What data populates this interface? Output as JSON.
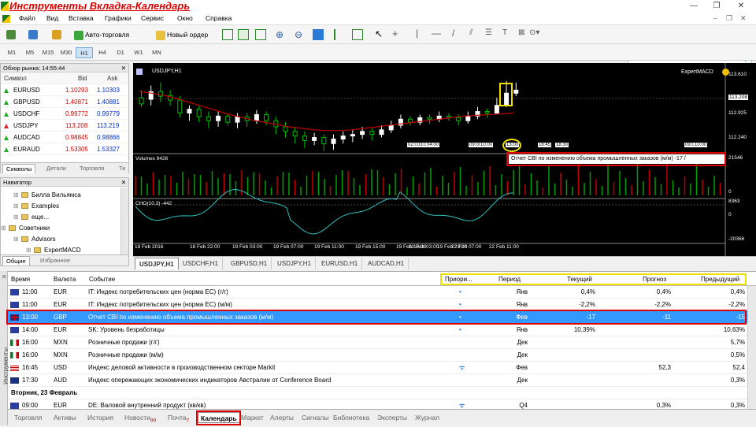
{
  "app": {
    "title": "Инструменты Вкладка-Календарь",
    "controls": [
      "—",
      "❐",
      "✕"
    ]
  },
  "menu": [
    "Файл",
    "Вид",
    "Вставка",
    "Графики",
    "Сервис",
    "Окно",
    "Справка"
  ],
  "toolbar": {
    "autotrade_label": "Авто-торговля",
    "neworder_label": "Новый ордер",
    "search_placeholder": ""
  },
  "timeframes": [
    "M1",
    "M5",
    "M15",
    "M30",
    "H1",
    "H4",
    "D1",
    "W1",
    "MN"
  ],
  "timeframe_active": "H1",
  "market_watch": {
    "title": "Обзор рынка: 14:55:44",
    "headers": [
      "Символ",
      "Bid",
      "Ask"
    ],
    "rows": [
      {
        "symbol": "EURUSD",
        "bid": "1.10293",
        "ask": "1.10303",
        "dir": "up"
      },
      {
        "symbol": "GBPUSD",
        "bid": "1.40871",
        "ask": "1.40881",
        "dir": "up"
      },
      {
        "symbol": "USDCHF",
        "bid": "0.99772",
        "ask": "0.99779",
        "dir": "up"
      },
      {
        "symbol": "USDJPY",
        "bid": "113.208",
        "ask": "113.219",
        "dir": "down"
      },
      {
        "symbol": "AUDCAD",
        "bid": "0.98845",
        "ask": "0.98866",
        "dir": "up"
      },
      {
        "symbol": "EURAUD",
        "bid": "1.53305",
        "ask": "1.53327",
        "dir": "up"
      }
    ],
    "tabs": [
      "Символы",
      "Детали",
      "Торговля",
      "Ти"
    ]
  },
  "navigator": {
    "title": "Навигатор",
    "items": [
      {
        "label": "Билла Вильямса",
        "indent": 1
      },
      {
        "label": "Examples",
        "indent": 1
      },
      {
        "label": "еще...",
        "indent": 1
      },
      {
        "label": "Советники",
        "indent": 0
      },
      {
        "label": "Advisors",
        "indent": 1
      },
      {
        "label": "ExpertMACD",
        "indent": 2
      }
    ],
    "tabs": [
      "Общие",
      "Избранное"
    ]
  },
  "chart": {
    "symbol_label": "USDJPY,H1",
    "expert_label": "ExpertMACD",
    "volumes_label": "Volumes 9426",
    "cho_label": "CHO(10,3) -442",
    "price_ticks": [
      "113.610",
      "113.208",
      "112.925",
      "112.240"
    ],
    "volume_ticks": [
      "21546",
      "0"
    ],
    "cho_ticks": [
      "8363",
      "0",
      "-20366"
    ],
    "x_ticks": [
      "18 Feb 2016",
      "18 Feb 22:00",
      "19 Feb 03:00",
      "19 Feb 07:00",
      "19 Feb 11:00",
      "19 Feb 15:00",
      "19 Feb 19:00",
      "19 Feb 23:00",
      "22 Feb 03:00",
      "22 Feb 07:00",
      "22 Feb 11:00"
    ],
    "event_marks": [
      "02:00",
      "03:00",
      "04:00",
      "09:00",
      "10:00",
      "13:00",
      "16:45",
      "18:30",
      "09:00",
      "10:00"
    ],
    "tooltip": "Отчет CBI по изменению объема промышленных заказов (м/м) -17 /"
  },
  "chart_tabs": [
    "USDJPY,H1",
    "USDCHF,H1",
    "GBPUSD,H1",
    "USDJPY,H1",
    "EURUSD,H1",
    "AUDCAD,H1"
  ],
  "calendar": {
    "headers": [
      "Время",
      "Валюта",
      "Событие",
      "Приори...",
      "Период",
      "Текущий",
      "Прогноз",
      "Предыдущий"
    ],
    "rows": [
      {
        "time": "11:00",
        "flag": "eu",
        "currency": "EUR",
        "event": "IT: Индекс потребительских цен (норма ЕС) (г/г)",
        "priority": "•",
        "period": "Янв",
        "current": "0,4%",
        "forecast": "0,4%",
        "previous": "0,4%"
      },
      {
        "time": "11:00",
        "flag": "eu",
        "currency": "EUR",
        "event": "IT: Индекс потребительских цен (норма ЕС) (м/м)",
        "priority": "•",
        "period": "Янв",
        "current": "-2,2%",
        "forecast": "-2,2%",
        "previous": "-2,2%"
      },
      {
        "time": "13:00",
        "flag": "gb",
        "currency": "GBP",
        "event": "Отчет CBI по изменению объема промышленных заказов (м/м)",
        "priority": "•",
        "period": "Фев",
        "current": "-17",
        "forecast": "-11",
        "previous": "-15",
        "selected": true
      },
      {
        "time": "14:00",
        "flag": "eu",
        "currency": "EUR",
        "event": "SK: Уровень безработицы",
        "priority": "•",
        "period": "Янв",
        "current": "10,39%",
        "forecast": "",
        "previous": "10,63%"
      },
      {
        "time": "16:00",
        "flag": "mx",
        "currency": "MXN",
        "event": "Розничные продажи (г/г)",
        "priority": "",
        "period": "Дек",
        "current": "",
        "forecast": "",
        "previous": "5,7%"
      },
      {
        "time": "16:00",
        "flag": "mx",
        "currency": "MXN",
        "event": "Розничные продажи (м/м)",
        "priority": "",
        "period": "Дек",
        "current": "",
        "forecast": "",
        "previous": "0,5%"
      },
      {
        "time": "16:45",
        "flag": "us",
        "currency": "USD",
        "event": "Индекс деловой активности в производственном секторе Markit",
        "priority": "ᯤ",
        "period": "Фев",
        "current": "",
        "forecast": "52,3",
        "previous": "52,4"
      },
      {
        "time": "17:30",
        "flag": "au",
        "currency": "AUD",
        "event": "Индекс опережающих экономических индикаторов Австралии от Conference Board",
        "priority": "",
        "period": "Дек",
        "current": "",
        "forecast": "",
        "previous": "0,3%"
      }
    ],
    "group_label": "Вторник, 23 Февраль",
    "after_group": [
      {
        "time": "09:00",
        "flag": "eu",
        "currency": "EUR",
        "event": "DE: Валовой внутренний продукт (кв/кв)",
        "priority": "ᯤ",
        "period": "Q4",
        "current": "",
        "forecast": "0,3%",
        "previous": "0,3%"
      }
    ]
  },
  "terminal_side_label": "Инструменты",
  "bottom_tabs": [
    {
      "label": "Торговля"
    },
    {
      "label": "Активы"
    },
    {
      "label": "История"
    },
    {
      "label": "Новости",
      "badge": "99"
    },
    {
      "label": "Почта",
      "badge": "7"
    },
    {
      "label": "Календарь",
      "active": true
    },
    {
      "label": "Маркет"
    },
    {
      "label": "Алерты"
    },
    {
      "label": "Сигналы"
    },
    {
      "label": "Библиотека"
    },
    {
      "label": "Эксперты"
    },
    {
      "label": "Журнал"
    }
  ],
  "colors": {
    "highlight_red": "#e00000",
    "highlight_yellow": "#f0e000",
    "selected_row": "#3399ff",
    "bull_candle": "#ffffff",
    "bear_candle": "#00c000",
    "ma_line": "#c00000"
  }
}
